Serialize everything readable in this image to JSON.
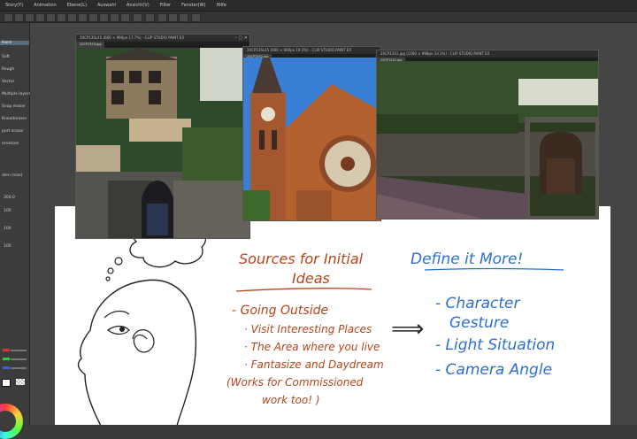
{
  "menu": {
    "items": [
      "Story(Y)",
      "Animation",
      "Ebene(L)",
      "Auswahl",
      "Ansicht(V)",
      "Filter",
      "Fenster(W)",
      "Hilfe"
    ]
  },
  "left_panel": {
    "items": [
      "Hard",
      "Soft",
      "Rough",
      "Vector",
      "Multiple layers",
      "Snap eraser",
      "Kneaderaser",
      "port eraser",
      "ersetzen"
    ],
    "header": "dien (size)",
    "values": [
      "300.0",
      "100",
      "100",
      "100"
    ]
  },
  "windows": [
    {
      "title": "20CP13SL45 (660 × 990px 17.7%) - CLIP STUDIO PAINT EX",
      "tab": "20CP1354.jpg"
    },
    {
      "title": "20CP13SL45 (660 × 990px 19.3%) - CLIP STUDIO PAINT EX",
      "tab": "20CP1352.jpg"
    },
    {
      "title": "20CP1241.jpg (1500 × 998px 33.1%) - CLIP STUDIO PAINT EX",
      "tab": "20CP1241.jpg"
    }
  ],
  "notes": {
    "sources_title_line1": "Sources for Initial",
    "sources_title_line2": "Ideas",
    "going_outside": "- Going Outside",
    "bullets": [
      "· Visit Interesting Places",
      "· The Area where you live",
      "· Fantasize and Daydream"
    ],
    "commissioned_line1": "(Works for Commissioned",
    "commissioned_line2": "work too! )",
    "arrow": "⟹",
    "define_title": "Define it More!",
    "define_items": [
      "- Character",
      "Gesture",
      "- Light Situation",
      "- Camera Angle"
    ]
  },
  "colors": {
    "brown_ink": "#b5451b",
    "blue_ink": "#2c6fd1",
    "panel_bg": "#3c3c3c"
  }
}
